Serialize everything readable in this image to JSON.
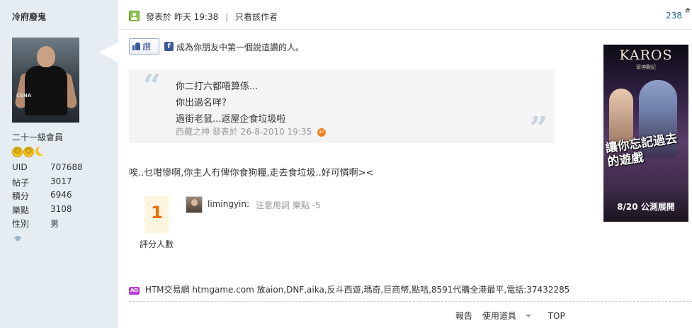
{
  "sidebar": {
    "author_name": "冷府廢鬼",
    "avatar_text": "CENA",
    "rank": "二十一級會員",
    "stats": [
      {
        "key": "UID",
        "value": "707688"
      },
      {
        "key": "帖子",
        "value": "3017"
      },
      {
        "key": "積分",
        "value": "6946"
      },
      {
        "key": "樂點",
        "value": "3108"
      },
      {
        "key": "性別",
        "value": "男"
      }
    ],
    "icons": [
      "smiley-medal-icon",
      "smiley-medal-icon",
      "moon-medal-icon",
      "online-status-icon"
    ]
  },
  "post": {
    "header": {
      "posted_label": "發表於",
      "posted_time": "昨天 19:38",
      "separator": "|",
      "author_only_link": "只看該作者",
      "post_number": "238",
      "hash": "#"
    },
    "like": {
      "button_label": "讚",
      "fb_letter": "f",
      "text": "成為你朋友中第一個說這讚的人。"
    },
    "quote": {
      "lines": [
        "你二打六都唔算係...",
        "你出過名咩?",
        "過街老鼠...返屋企食垃圾啦"
      ],
      "cite_author": "西藏之神",
      "cite_posted": "發表於",
      "cite_time": "26-8-2010 19:35"
    },
    "reply_text": "唉..乜咁慘啊,你主人冇俾你食狗糧,走去食垃圾..好可憐啊><",
    "rating": {
      "count": "1",
      "label": "評分人數",
      "rater_name": "limingyin:",
      "rater_note": "注意用詞 樂點 -5"
    },
    "ad_line": {
      "badge": "AD",
      "text": "HTM交易網 htmgame.com 放aion,DNF,aika,反斗西遊,瑪奇,巨商幣,點咭,8591代購全港最平,電話:37432285"
    },
    "footer": {
      "report": "報告",
      "tools": "使用道具",
      "top": "TOP"
    }
  },
  "banner": {
    "logo": "KAROS",
    "subtitle": "眾神戰紀",
    "headline": "讓你忘記過去的遊戲",
    "footer": "8/20 公測展開"
  },
  "colors": {
    "sidebar_bg": "#e5edf2",
    "link_blue": "#2a6496",
    "rating_orange": "#f26c00",
    "fb_blue": "#3b5998"
  }
}
